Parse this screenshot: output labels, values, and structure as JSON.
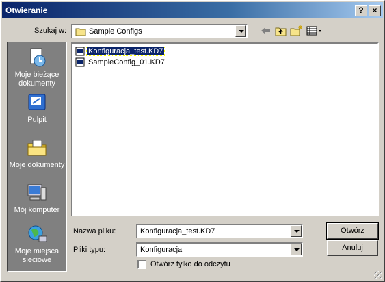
{
  "window": {
    "title": "Otwieranie",
    "help_button": "?",
    "close_button": "×"
  },
  "lookin": {
    "label": "Szukaj w:",
    "value": "Sample Configs",
    "folder_icon": "folder-icon"
  },
  "toolbar": {
    "icons": [
      "back-arrow-icon",
      "up-folder-icon",
      "new-folder-icon",
      "view-menu-icon"
    ]
  },
  "places": [
    {
      "label": "Moje bieżące dokumenty",
      "icon": "recent-documents-icon"
    },
    {
      "label": "Pulpit",
      "icon": "desktop-icon"
    },
    {
      "label": "Moje dokumenty",
      "icon": "my-documents-icon"
    },
    {
      "label": "Mój komputer",
      "icon": "my-computer-icon"
    },
    {
      "label": "Moje miejsca sieciowe",
      "icon": "network-places-icon"
    }
  ],
  "files": [
    {
      "name": "Konfiguracja_test.KD7",
      "selected": true
    },
    {
      "name": "SampleConfig_01.KD7",
      "selected": false
    }
  ],
  "filename": {
    "label": "Nazwa pliku:",
    "value": "Konfiguracja_test.KD7"
  },
  "filetype": {
    "label": "Pliki typu:",
    "value": "Konfiguracja"
  },
  "readonly": {
    "label": "Otwórz tylko do odczytu",
    "checked": false
  },
  "buttons": {
    "open": "Otwórz",
    "cancel": "Anuluj"
  },
  "colors": {
    "title_bar": "#0a246a",
    "dialog_face": "#d4d0c8",
    "places_bar": "#808080",
    "selection": "#0a246a"
  }
}
